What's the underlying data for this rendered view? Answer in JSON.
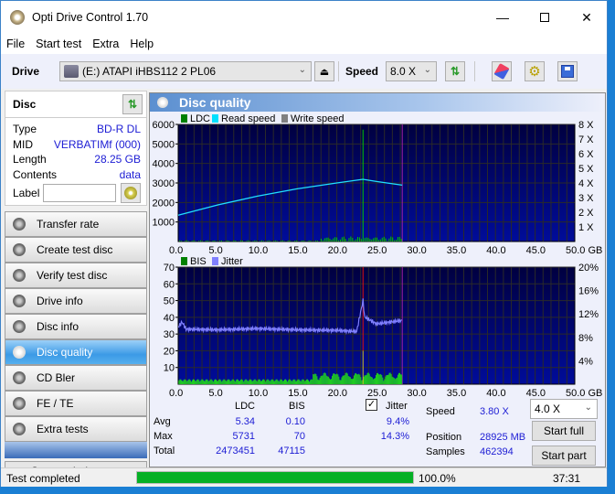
{
  "window": {
    "title": "Opti Drive Control 1.70",
    "controls": [
      "minimize",
      "maximize",
      "close"
    ]
  },
  "menu": [
    "File",
    "Start test",
    "Extra",
    "Help"
  ],
  "toolbar": {
    "drive_label": "Drive",
    "drive_value": "(E:)  ATAPI iHBS112  2 PL06",
    "speed_label": "Speed",
    "speed_value": "8.0 X"
  },
  "disc": {
    "header": "Disc",
    "type_label": "Type",
    "type": "BD-R DL",
    "mid_label": "MID",
    "mid": "VERBATIMf (000)",
    "length_label": "Length",
    "length": "28.25 GB",
    "contents_label": "Contents",
    "contents": "data",
    "label_label": "Label",
    "label_value": ""
  },
  "nav": [
    {
      "label": "Transfer rate",
      "active": false
    },
    {
      "label": "Create test disc",
      "active": false
    },
    {
      "label": "Verify test disc",
      "active": false
    },
    {
      "label": "Drive info",
      "active": false
    },
    {
      "label": "Disc info",
      "active": false
    },
    {
      "label": "Disc quality",
      "active": true
    },
    {
      "label": "CD Bler",
      "active": false
    },
    {
      "label": "FE / TE",
      "active": false
    },
    {
      "label": "Extra tests",
      "active": false
    }
  ],
  "status_window_label": "Status window > >",
  "panel_title": "Disc quality",
  "chart_data": [
    {
      "type": "bar",
      "title": "LDC / Read speed",
      "legend": [
        "LDC",
        "Read speed",
        "Write speed"
      ],
      "legend_colors": [
        "#008000",
        "#00e0ff",
        "#808080"
      ],
      "xlabel": "GB",
      "x_ticks": [
        "0.0",
        "5.0",
        "10.0",
        "15.0",
        "20.0",
        "25.0",
        "30.0",
        "35.0",
        "40.0",
        "45.0",
        "50.0 GB"
      ],
      "xlim": [
        0,
        50
      ],
      "y_ticks": [
        "1000",
        "2000",
        "3000",
        "4000",
        "5000",
        "6000"
      ],
      "ylim": [
        0,
        6000
      ],
      "y2_ticks": [
        "1 X",
        "2 X",
        "3 X",
        "4 X",
        "5 X",
        "6 X",
        "7 X",
        "8 X"
      ],
      "y2lim": [
        0,
        8
      ],
      "read_speed": {
        "x": [
          0,
          5,
          10,
          15,
          20,
          23.3,
          25,
          28.25
        ],
        "y": [
          1.8,
          2.5,
          3.1,
          3.6,
          4.0,
          4.25,
          4.1,
          3.85
        ]
      },
      "ldc_spike": {
        "x": 23.3,
        "y": 5731
      },
      "end_marker_x": 28.25
    },
    {
      "type": "bar",
      "title": "BIS / Jitter",
      "legend": [
        "BIS",
        "Jitter"
      ],
      "legend_colors": [
        "#008000",
        "#8080ff"
      ],
      "xlabel": "GB",
      "x_ticks": [
        "0.0",
        "5.0",
        "10.0",
        "15.0",
        "20.0",
        "25.0",
        "30.0",
        "35.0",
        "40.0",
        "45.0",
        "50.0 GB"
      ],
      "xlim": [
        0,
        50
      ],
      "y_ticks": [
        "10",
        "20",
        "30",
        "40",
        "50",
        "60",
        "70"
      ],
      "ylim": [
        0,
        70
      ],
      "y2_ticks": [
        "4%",
        "8%",
        "12%",
        "16%",
        "20%"
      ],
      "y2lim": [
        0,
        20
      ],
      "jitter": {
        "x": [
          0,
          0.5,
          1,
          5,
          10,
          15,
          20,
          22.5,
          23.3,
          23.5,
          25,
          28.25
        ],
        "y": [
          9.8,
          10.6,
          9.4,
          9.3,
          9.5,
          9.3,
          9.2,
          9.0,
          14.3,
          11.5,
          10.3,
          10.9
        ]
      },
      "bis_spike": {
        "x": 23.3,
        "y": 70
      },
      "end_marker_x": 28.25
    }
  ],
  "stats": {
    "col_ldc": "LDC",
    "col_bis": "BIS",
    "jitter_label": "Jitter",
    "jitter_checked": true,
    "avg_label": "Avg",
    "avg_ldc": "5.34",
    "avg_bis": "0.10",
    "avg_jitter": "9.4%",
    "max_label": "Max",
    "max_ldc": "5731",
    "max_bis": "70",
    "max_jitter": "14.3%",
    "total_label": "Total",
    "total_ldc": "2473451",
    "total_bis": "47115",
    "speed_label": "Speed",
    "speed": "3.80 X",
    "position_label": "Position",
    "position": "28925 MB",
    "samples_label": "Samples",
    "samples": "462394",
    "speed_select": "4.0 X",
    "start_full": "Start full",
    "start_part": "Start part"
  },
  "statusbar": {
    "text": "Test completed",
    "progress": 100,
    "progress_text": "100.0%",
    "time": "37:31"
  }
}
